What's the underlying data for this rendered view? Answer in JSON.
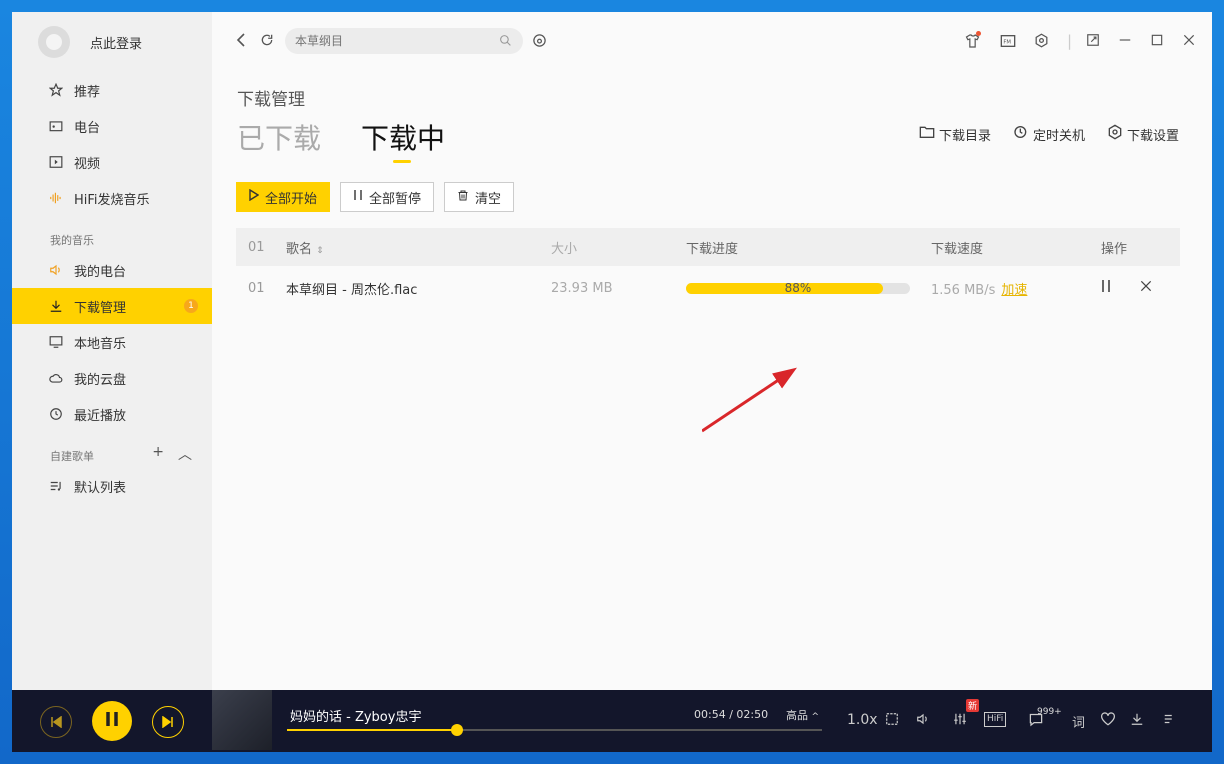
{
  "sidebar": {
    "login_text": "点此登录",
    "nav": [
      {
        "label": "推荐",
        "icon": "star-icon"
      },
      {
        "label": "电台",
        "icon": "radio-icon"
      },
      {
        "label": "视频",
        "icon": "video-icon"
      },
      {
        "label": "HiFi发烧音乐",
        "icon": "hifi-wave-icon"
      }
    ],
    "my_music_title": "我的音乐",
    "my_music": [
      {
        "label": "我的电台",
        "icon": "speaker-icon"
      },
      {
        "label": "下载管理",
        "icon": "download-icon",
        "badge": "1"
      },
      {
        "label": "本地音乐",
        "icon": "monitor-icon"
      },
      {
        "label": "我的云盘",
        "icon": "cloud-icon"
      },
      {
        "label": "最近播放",
        "icon": "clock-icon"
      }
    ],
    "playlists_title": "自建歌单",
    "playlists": [
      {
        "label": "默认列表",
        "icon": "playlist-icon"
      }
    ]
  },
  "topbar": {
    "search_placeholder": "本草纲目"
  },
  "page": {
    "breadcrumb": "下载管理",
    "tabs": [
      "已下载",
      "下载中"
    ],
    "active_tab": 1,
    "right_links": [
      "下载目录",
      "定时关机",
      "下载设置"
    ],
    "buttons": {
      "start_all": "全部开始",
      "pause_all": "全部暂停",
      "clear": "清空"
    }
  },
  "table": {
    "headers": [
      "01",
      "歌名",
      "大小",
      "下载进度",
      "下载速度",
      "操作"
    ],
    "rows": [
      {
        "index": "01",
        "name": "本草纲目 - 周杰伦.flac",
        "size": "23.93 MB",
        "progress": 0.88,
        "progress_text": "88%",
        "speed": "1.56 MB/s",
        "accelerate": "加速"
      }
    ]
  },
  "player": {
    "song": "妈妈的话 - Zyboy忠宇",
    "time": "00:54 / 02:50",
    "quality": "高品",
    "speed": "1.0x",
    "position": 0.318,
    "new_badge": "新",
    "hifi_label": "HiFi",
    "comment_count": "999+",
    "lyric_label": "词"
  },
  "colors": {
    "accent": "#ffd100",
    "player_bg": "#13162b",
    "sidebar_bg": "#f0f0f0"
  }
}
